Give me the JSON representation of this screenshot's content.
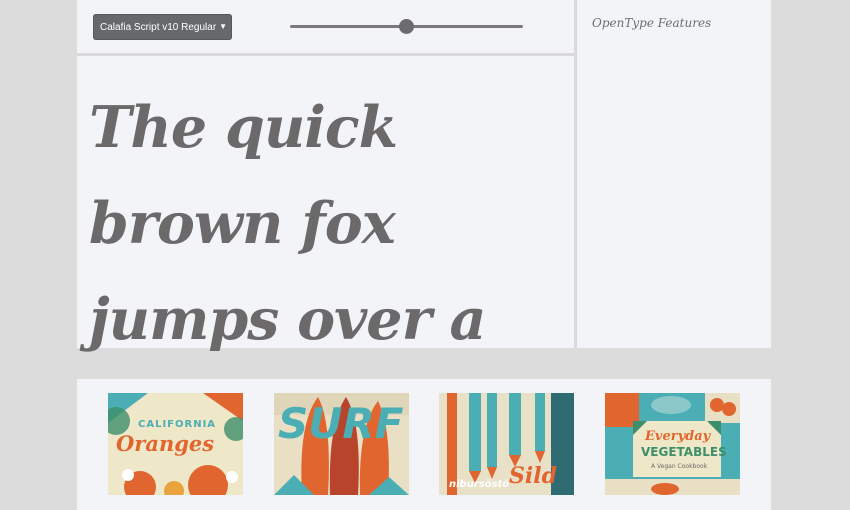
{
  "toolbar": {
    "font_select_value": "Calafia Script v10 Regular",
    "size_slider_level": 0.5
  },
  "preview": {
    "text": "The quick brown fox jumps over a lazy dog."
  },
  "sidebar": {
    "title": "OpenType Features"
  },
  "gallery": {
    "items": [
      {
        "line1": "CALIFORNIA",
        "line2": "Oranges"
      },
      {
        "line1": "SURF"
      },
      {
        "line1": "nibursöstö",
        "line2": "Sild"
      },
      {
        "line1": "Everyday",
        "line2": "VEGETABLES",
        "line3": "A Vegan Cookbook"
      }
    ]
  },
  "colors": {
    "accent_teal": "#4aaeb4",
    "accent_orange": "#e0652f",
    "preview_text": "#6b696a"
  }
}
